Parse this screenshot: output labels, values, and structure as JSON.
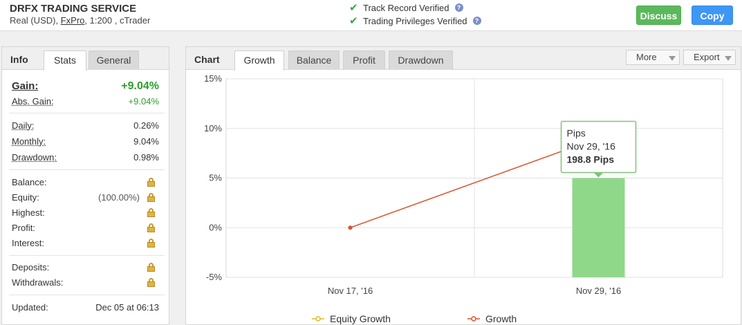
{
  "header": {
    "system_name": "DRFX TRADING SERVICE",
    "account_type": "Real (USD),",
    "broker": "FxPro",
    "leverage_platform": ", 1:200 , cTrader",
    "track_record": "Track Record Verified",
    "trading_privileges": "Trading Privileges Verified",
    "help_icon": "question-icon",
    "check_icon": "check-icon",
    "discuss_label": "Discuss",
    "copy_label": "Copy",
    "discuss_color": "#5cb85c",
    "copy_color": "#3f97f5"
  },
  "left": {
    "title": "Info",
    "tabs": [
      "Stats",
      "General"
    ],
    "active_tab": "Stats",
    "gain": {
      "label": "Gain:",
      "value": "+9.04%"
    },
    "abs_gain": {
      "label": "Abs. Gain:",
      "value": "+9.04%"
    },
    "daily": {
      "label": "Daily:",
      "value": "0.26%"
    },
    "monthly": {
      "label": "Monthly:",
      "value": "9.04%"
    },
    "drawdown": {
      "label": "Drawdown:",
      "value": "0.98%"
    },
    "balance": {
      "label": "Balance:"
    },
    "equity": {
      "label": "Equity:",
      "value": "(100.00%)"
    },
    "highest": {
      "label": "Highest:"
    },
    "profit": {
      "label": "Profit:"
    },
    "interest": {
      "label": "Interest:"
    },
    "deposits": {
      "label": "Deposits:"
    },
    "withdrawals": {
      "label": "Withdrawals:"
    },
    "updated": {
      "label": "Updated:",
      "value": "Dec 05 at 06:13"
    },
    "lock_icon": "lock-icon"
  },
  "right": {
    "title": "Chart",
    "tabs": [
      "Growth",
      "Balance",
      "Profit",
      "Drawdown"
    ],
    "active_tab": "Growth",
    "more_label": "More",
    "export_label": "Export"
  },
  "chart_data": {
    "type": "line",
    "categories": [
      "Nov 17, '16",
      "Nov 29, '16"
    ],
    "y_ticks": [
      "15%",
      "10%",
      "5%",
      "0%",
      "-5%"
    ],
    "ylim": [
      -5,
      15
    ],
    "grid": true,
    "legend_position": "bottom",
    "series": [
      {
        "name": "Equity Growth",
        "type": "line",
        "color": "#e6b922",
        "values": []
      },
      {
        "name": "Growth",
        "type": "line",
        "color": "#d9532c",
        "values": [
          0,
          9.04
        ]
      },
      {
        "name": "Pips",
        "type": "bar",
        "color": "#8fd88a",
        "values": [
          0,
          198.8
        ]
      }
    ],
    "tooltip": {
      "series": "Pips",
      "date": "Nov 29, '16",
      "value": "198.8 Pips"
    }
  }
}
